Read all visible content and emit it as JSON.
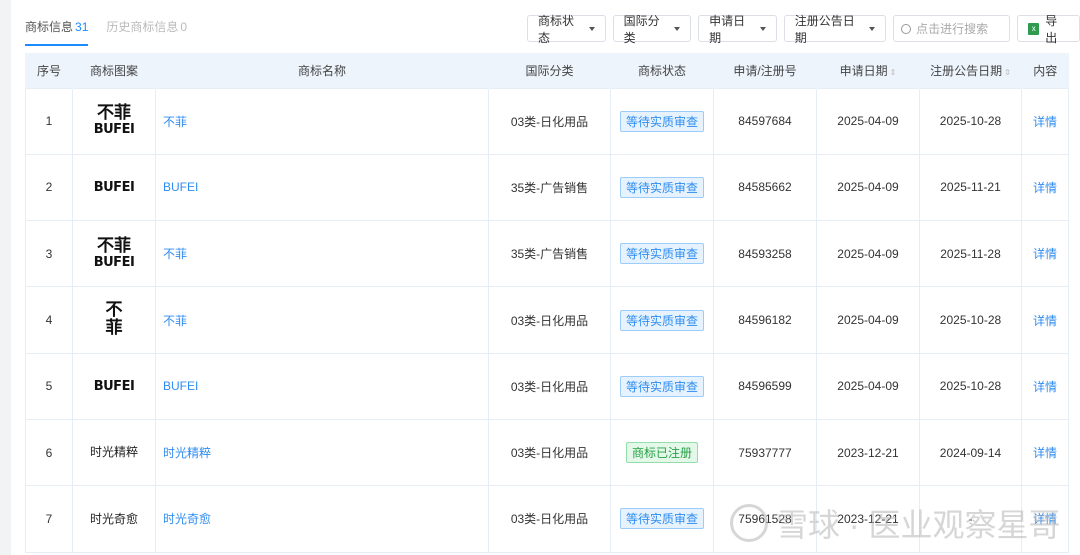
{
  "tabs": [
    {
      "label": "商标信息",
      "count": "31"
    },
    {
      "label": "历史商标信息",
      "count": "0"
    }
  ],
  "toolbar": {
    "status": "商标状态",
    "class": "国际分类",
    "apply_date": "申请日期",
    "pub_date": "注册公告日期",
    "search_placeholder": "点击进行搜索",
    "export": "导出"
  },
  "headers": [
    "序号",
    "商标图案",
    "商标名称",
    "国际分类",
    "商标状态",
    "申请/注册号",
    "申请日期",
    "注册公告日期",
    "内容"
  ],
  "rows": [
    {
      "no": "1",
      "logo_cn": "不菲",
      "logo_en": "BUFEI",
      "name": "不菲",
      "class": "03类-日化用品",
      "status": "等待实质审查",
      "status_type": "wait",
      "reg_no": "84597684",
      "apply": "2025-04-09",
      "pub": "2025-10-28",
      "action": "详情"
    },
    {
      "no": "2",
      "logo_cn": "",
      "logo_en": "BUFEI",
      "name": "BUFEI",
      "class": "35类-广告销售",
      "status": "等待实质审查",
      "status_type": "wait",
      "reg_no": "84585662",
      "apply": "2025-04-09",
      "pub": "2025-11-21",
      "action": "详情"
    },
    {
      "no": "3",
      "logo_cn": "不菲",
      "logo_en": "BUFEI",
      "name": "不菲",
      "class": "35类-广告销售",
      "status": "等待实质审查",
      "status_type": "wait",
      "reg_no": "84593258",
      "apply": "2025-04-09",
      "pub": "2025-11-28",
      "action": "详情"
    },
    {
      "no": "4",
      "logo_cn": "不",
      "logo_cn2": "菲",
      "logo_en": "",
      "name": "不菲",
      "class": "03类-日化用品",
      "status": "等待实质审查",
      "status_type": "wait",
      "reg_no": "84596182",
      "apply": "2025-04-09",
      "pub": "2025-10-28",
      "action": "详情"
    },
    {
      "no": "5",
      "logo_cn": "",
      "logo_en": "BUFEI",
      "name": "BUFEI",
      "class": "03类-日化用品",
      "status": "等待实质审查",
      "status_type": "wait",
      "reg_no": "84596599",
      "apply": "2025-04-09",
      "pub": "2025-10-28",
      "action": "详情"
    },
    {
      "no": "6",
      "logo_text": "时光精粹",
      "name": "时光精粹",
      "class": "03类-日化用品",
      "status": "商标已注册",
      "status_type": "reg",
      "reg_no": "75937777",
      "apply": "2023-12-21",
      "pub": "2024-09-14",
      "action": "详情"
    },
    {
      "no": "7",
      "logo_text": "时光奇愈",
      "name": "时光奇愈",
      "class": "03类-日化用品",
      "status": "等待实质审查",
      "status_type": "wait",
      "reg_no": "75961528",
      "apply": "2023-12-21",
      "pub": "-",
      "action": "详情"
    }
  ],
  "watermark": "雪球 · 医业观察星哥",
  "colors": {
    "accent": "#2f8cf0",
    "header_bg": "#edf4fc",
    "registered": "#27a046"
  }
}
